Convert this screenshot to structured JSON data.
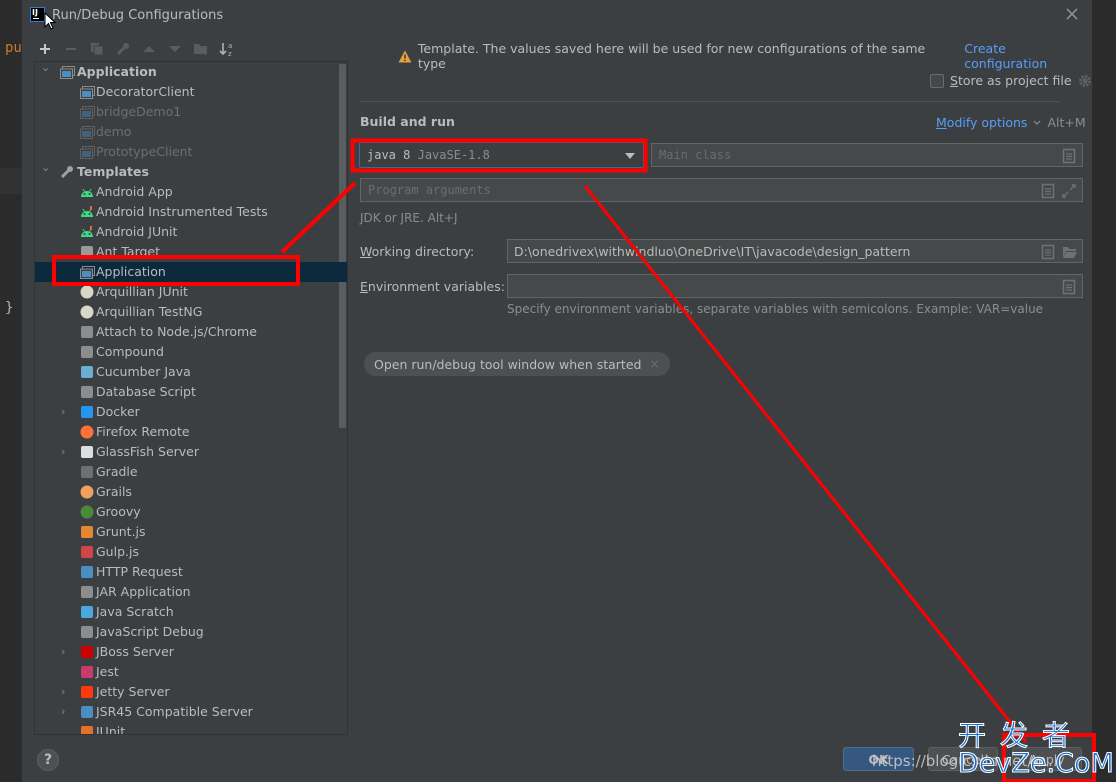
{
  "background_editor": {
    "code_fragments": [
      "pu",
      "}"
    ]
  },
  "dialog": {
    "title": "Run/Debug Configurations",
    "close_icon": "close-icon"
  },
  "toolbar": {
    "buttons": [
      {
        "name": "add",
        "glyph": "+",
        "enabled": true
      },
      {
        "name": "remove",
        "glyph": "−",
        "enabled": false
      },
      {
        "name": "copy",
        "glyph": "❐",
        "enabled": false
      },
      {
        "name": "edit-defaults",
        "glyph": "🔧",
        "enabled": false
      },
      {
        "name": "move-up",
        "glyph": "▲",
        "enabled": false
      },
      {
        "name": "move-down",
        "glyph": "▼",
        "enabled": false
      },
      {
        "name": "new-folder",
        "glyph": "📁",
        "enabled": false
      },
      {
        "name": "sort",
        "glyph": "↓ᵃᶻ",
        "enabled": true
      }
    ]
  },
  "tree": {
    "items": [
      {
        "label": "Application",
        "level": 0,
        "expanded": true,
        "bold": true,
        "icon": "application-icon"
      },
      {
        "label": "DecoratorClient",
        "level": 1,
        "icon": "application-config-icon"
      },
      {
        "label": "bridgeDemo1",
        "level": 1,
        "dim": true,
        "icon": "application-config-icon"
      },
      {
        "label": "demo",
        "level": 1,
        "dim": true,
        "icon": "application-config-icon"
      },
      {
        "label": "PrototypeClient",
        "level": 1,
        "dim": true,
        "icon": "application-config-icon"
      },
      {
        "label": "Templates",
        "level": 0,
        "expanded": true,
        "bold": true,
        "icon": "wrench-icon"
      },
      {
        "label": "Android App",
        "level": 1,
        "icon": "android-icon"
      },
      {
        "label": "Android Instrumented Tests",
        "level": 1,
        "icon": "android-test-icon"
      },
      {
        "label": "Android JUnit",
        "level": 1,
        "icon": "android-test-icon"
      },
      {
        "label": "Ant Target",
        "level": 1,
        "icon": "ant-icon"
      },
      {
        "label": "Application",
        "level": 1,
        "selected": true,
        "icon": "application-icon"
      },
      {
        "label": "Arquillian JUnit",
        "level": 1,
        "icon": "arquillian-icon"
      },
      {
        "label": "Arquillian TestNG",
        "level": 1,
        "icon": "arquillian-icon"
      },
      {
        "label": "Attach to Node.js/Chrome",
        "level": 1,
        "icon": "nodejs-attach-icon"
      },
      {
        "label": "Compound",
        "level": 1,
        "icon": "compound-icon"
      },
      {
        "label": "Cucumber Java",
        "level": 1,
        "icon": "cucumber-icon"
      },
      {
        "label": "Database Script",
        "level": 1,
        "icon": "database-script-icon"
      },
      {
        "label": "Docker",
        "level": 1,
        "collapsible": true,
        "icon": "docker-icon"
      },
      {
        "label": "Firefox Remote",
        "level": 1,
        "icon": "firefox-icon"
      },
      {
        "label": "GlassFish Server",
        "level": 1,
        "collapsible": true,
        "icon": "glassfish-icon"
      },
      {
        "label": "Gradle",
        "level": 1,
        "icon": "gradle-icon"
      },
      {
        "label": "Grails",
        "level": 1,
        "icon": "grails-icon"
      },
      {
        "label": "Groovy",
        "level": 1,
        "icon": "groovy-icon"
      },
      {
        "label": "Grunt.js",
        "level": 1,
        "icon": "grunt-icon"
      },
      {
        "label": "Gulp.js",
        "level": 1,
        "icon": "gulp-icon"
      },
      {
        "label": "HTTP Request",
        "level": 1,
        "icon": "http-request-icon"
      },
      {
        "label": "JAR Application",
        "level": 1,
        "icon": "jar-icon"
      },
      {
        "label": "Java Scratch",
        "level": 1,
        "icon": "java-scratch-icon"
      },
      {
        "label": "JavaScript Debug",
        "level": 1,
        "icon": "javascript-debug-icon"
      },
      {
        "label": "JBoss Server",
        "level": 1,
        "collapsible": true,
        "icon": "jboss-icon"
      },
      {
        "label": "Jest",
        "level": 1,
        "icon": "jest-icon"
      },
      {
        "label": "Jetty Server",
        "level": 1,
        "collapsible": true,
        "icon": "jetty-icon"
      },
      {
        "label": "JSR45 Compatible Server",
        "level": 1,
        "collapsible": true,
        "icon": "jsr45-icon"
      },
      {
        "label": "JUnit",
        "level": 1,
        "icon": "junit-icon"
      }
    ]
  },
  "main": {
    "template_notice": "Template. The values saved here will be used for new configurations of the same type",
    "create_configuration_link": "Create configuration",
    "store_as_project_file": {
      "label": "Store as project file",
      "mnemonic": "S",
      "rest": "tore as project file",
      "checked": false
    },
    "section_title": "Build and run",
    "modify_options": {
      "label": "Modify options",
      "mnemonic": "M",
      "rest": "odify options",
      "shortcut": "Alt+M"
    },
    "jdk": {
      "value": "java 8",
      "detail": "JavaSE-1.8",
      "hint": "JDK or JRE. Alt+J"
    },
    "main_class": {
      "placeholder": "Main class"
    },
    "program_arguments": {
      "placeholder": "Program arguments"
    },
    "working_directory": {
      "label": "Working directory:",
      "mnemonic": "W",
      "rest": "orking directory:",
      "value": "D:\\onedrivex\\withwindluo\\OneDrive\\IT\\javacode\\design_pattern"
    },
    "environment_variables": {
      "label": "Environment variables:",
      "mnemonic": "E",
      "rest": "nvironment variables:",
      "value": "",
      "hint": "Specify environment variables, separate variables with semicolons. Example: VAR=value"
    },
    "chip": {
      "label": "Open run/debug tool window when started",
      "close": "×"
    }
  },
  "footer": {
    "help": "?",
    "ok": "OK",
    "cancel": "Cancel",
    "apply": "Apply"
  },
  "overlay": {
    "highlight_color": "#ff0000",
    "watermark_cn": "开发者",
    "watermark_en": "DevZe.CoM",
    "watermark_url": "https://blog.csdn.net/w..."
  }
}
